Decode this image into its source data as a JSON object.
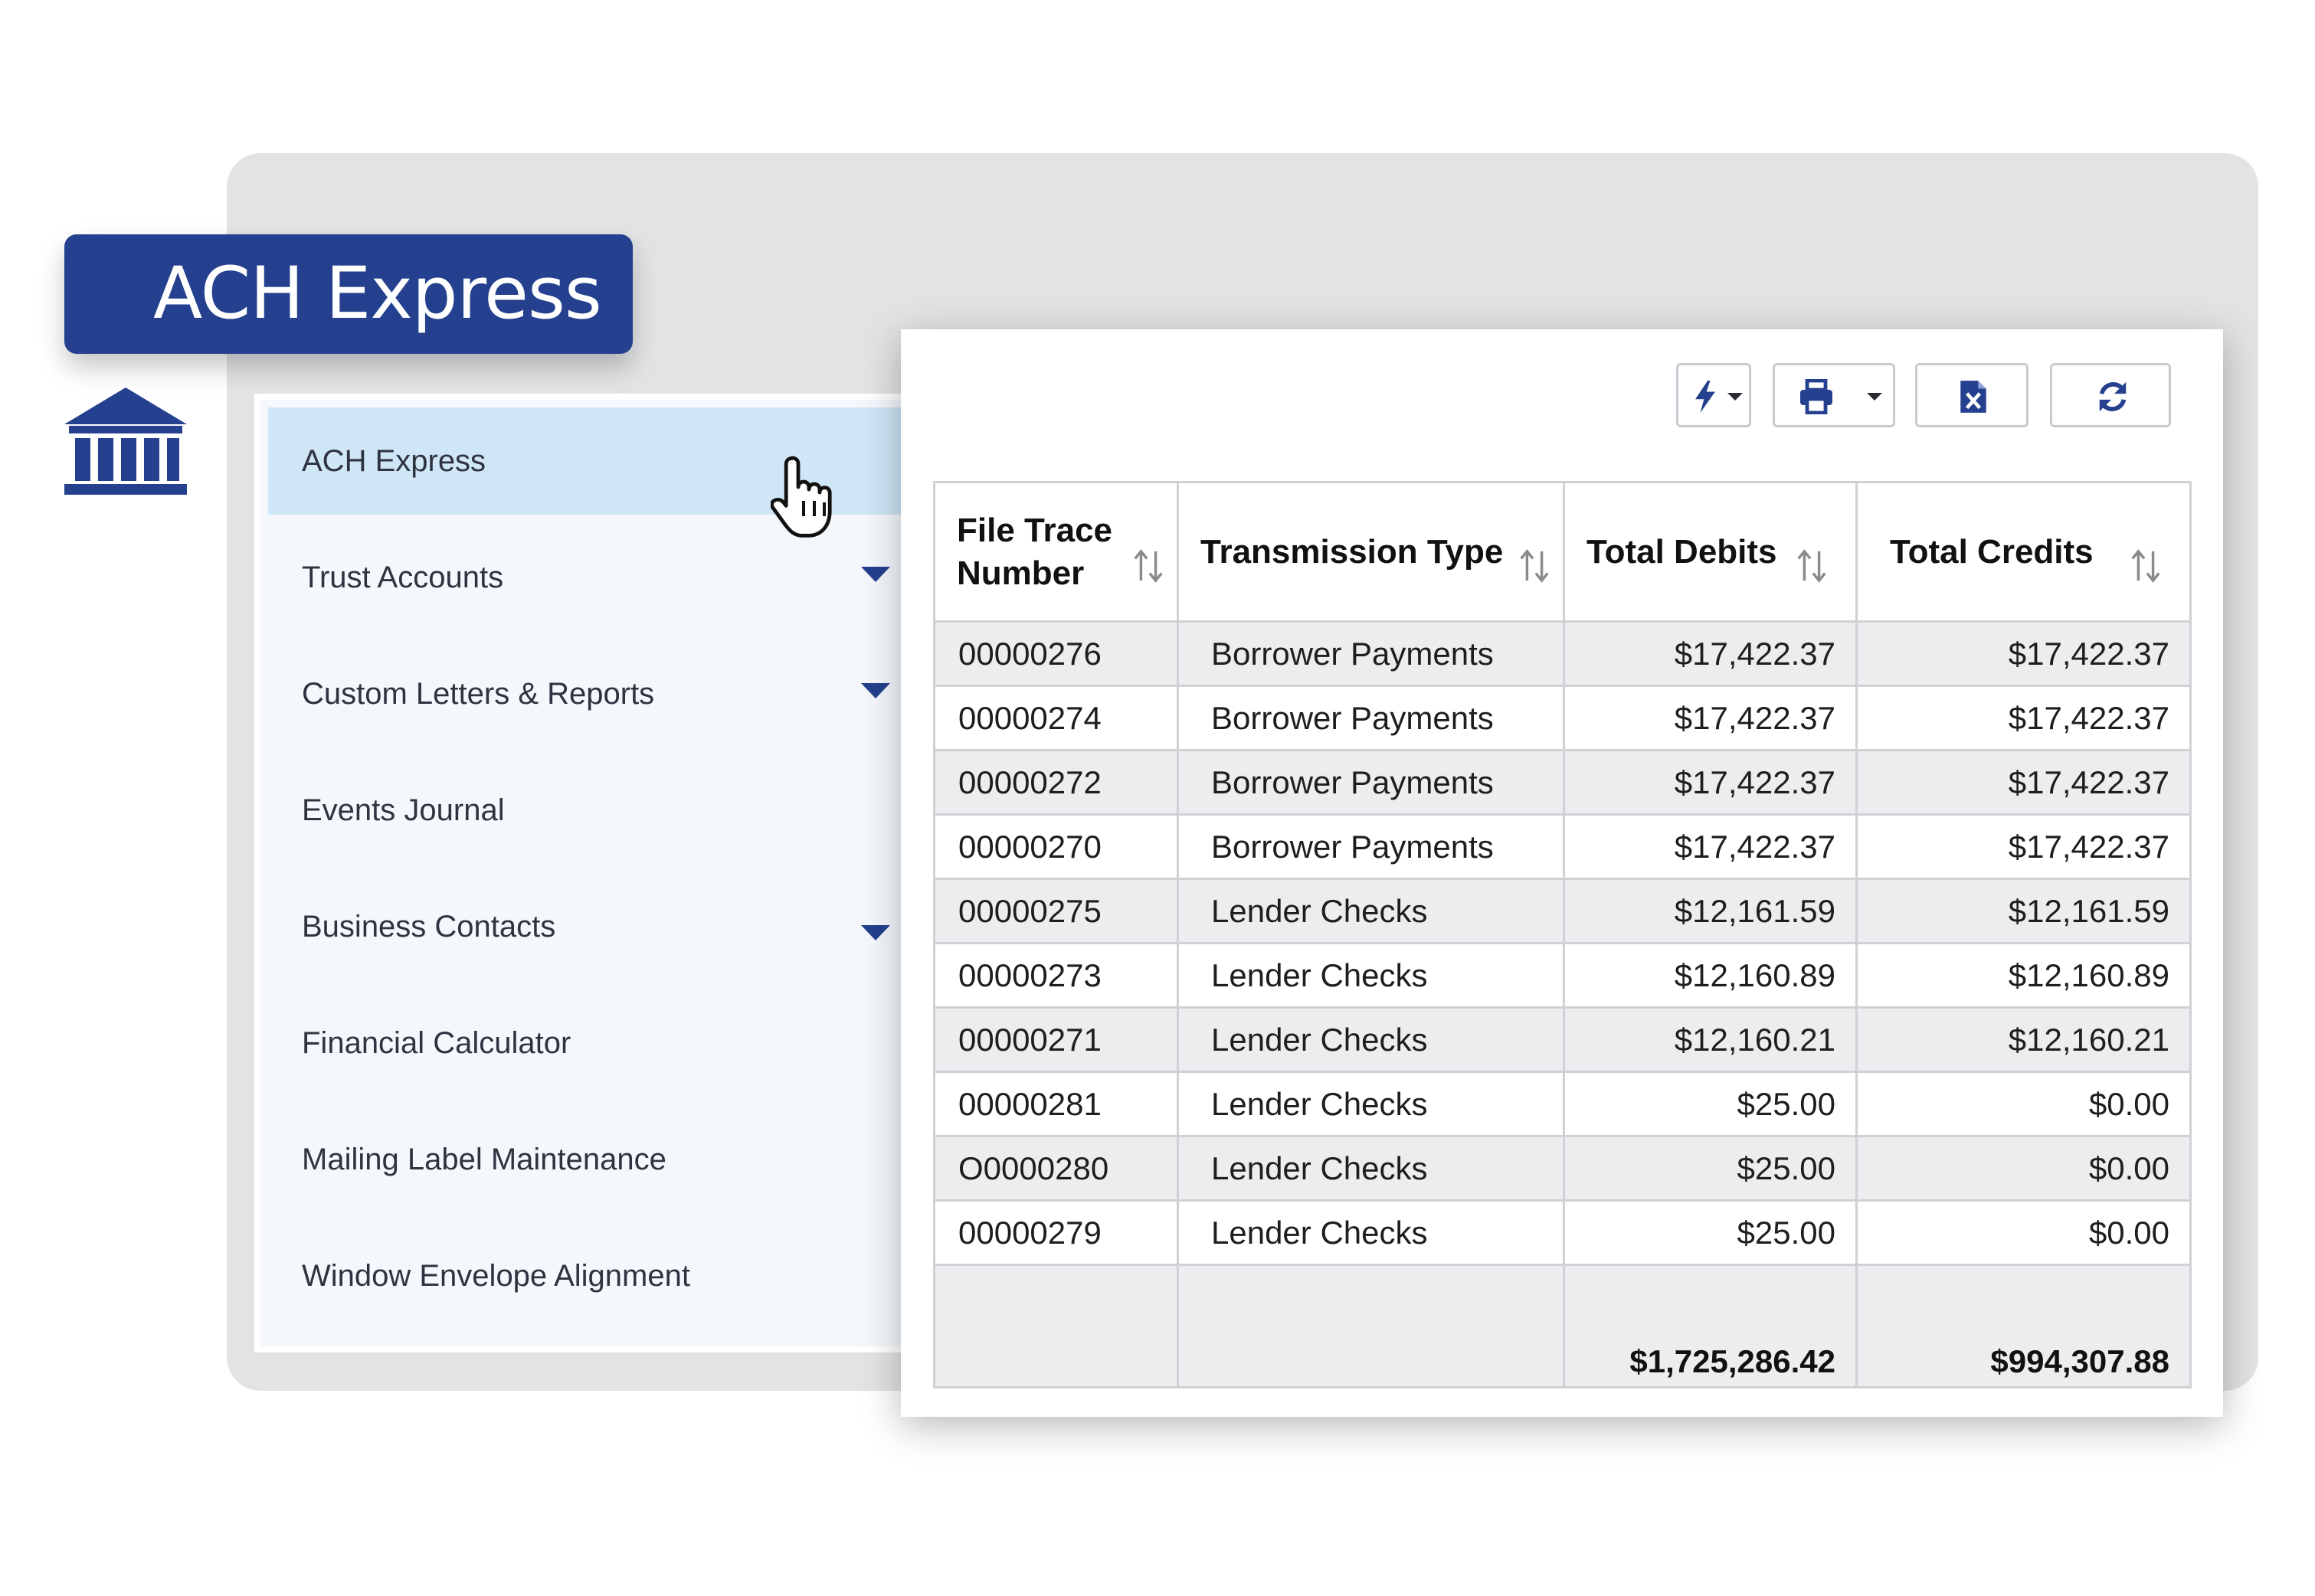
{
  "app": {
    "title": "ACH Express"
  },
  "sidebar": {
    "items": [
      {
        "label": "ACH Express",
        "active": true,
        "has_submenu": false
      },
      {
        "label": "Trust Accounts",
        "active": false,
        "has_submenu": true
      },
      {
        "label": "Custom Letters & Reports",
        "active": false,
        "has_submenu": true
      },
      {
        "label": "Events Journal",
        "active": false,
        "has_submenu": false
      },
      {
        "label": "Business Contacts",
        "active": false,
        "has_submenu": true
      },
      {
        "label": "Financial Calculator",
        "active": false,
        "has_submenu": false
      },
      {
        "label": "Mailing Label Maintenance",
        "active": false,
        "has_submenu": false
      },
      {
        "label": "Window Envelope Alignment",
        "active": false,
        "has_submenu": false
      }
    ]
  },
  "toolbar": {
    "buttons": [
      {
        "icon": "lightning-icon",
        "has_dropdown": true
      },
      {
        "icon": "printer-icon",
        "has_dropdown": true
      },
      {
        "icon": "excel-export-icon",
        "has_dropdown": false
      },
      {
        "icon": "refresh-icon",
        "has_dropdown": false
      }
    ]
  },
  "table": {
    "columns": [
      "File Trace Number",
      "Transmission Type",
      "Total Debits",
      "Total Credits"
    ],
    "rows": [
      [
        "00000276",
        "Borrower Payments",
        "$17,422.37",
        "$17,422.37"
      ],
      [
        "00000274",
        "Borrower Payments",
        "$17,422.37",
        "$17,422.37"
      ],
      [
        "00000272",
        "Borrower Payments",
        "$17,422.37",
        "$17,422.37"
      ],
      [
        "00000270",
        "Borrower Payments",
        "$17,422.37",
        "$17,422.37"
      ],
      [
        "00000275",
        "Lender Checks",
        "$12,161.59",
        "$12,161.59"
      ],
      [
        "00000273",
        "Lender Checks",
        "$12,160.89",
        "$12,160.89"
      ],
      [
        "00000271",
        "Lender Checks",
        "$12,160.21",
        "$12,160.21"
      ],
      [
        "00000281",
        "Lender Checks",
        "$25.00",
        "$0.00"
      ],
      [
        "O0000280",
        "Lender Checks",
        "$25.00",
        "$0.00"
      ],
      [
        "00000279",
        "Lender Checks",
        "$25.00",
        "$0.00"
      ]
    ],
    "totals": {
      "debits": "$1,725,286.42",
      "credits": "$994,307.88"
    }
  },
  "colors": {
    "brand_navy": "#24408e",
    "active_item": "#cfe6f7",
    "sidebar_bg": "#f4f8fc",
    "row_shade": "#ecedef",
    "backdrop": "#e2e3e5"
  }
}
